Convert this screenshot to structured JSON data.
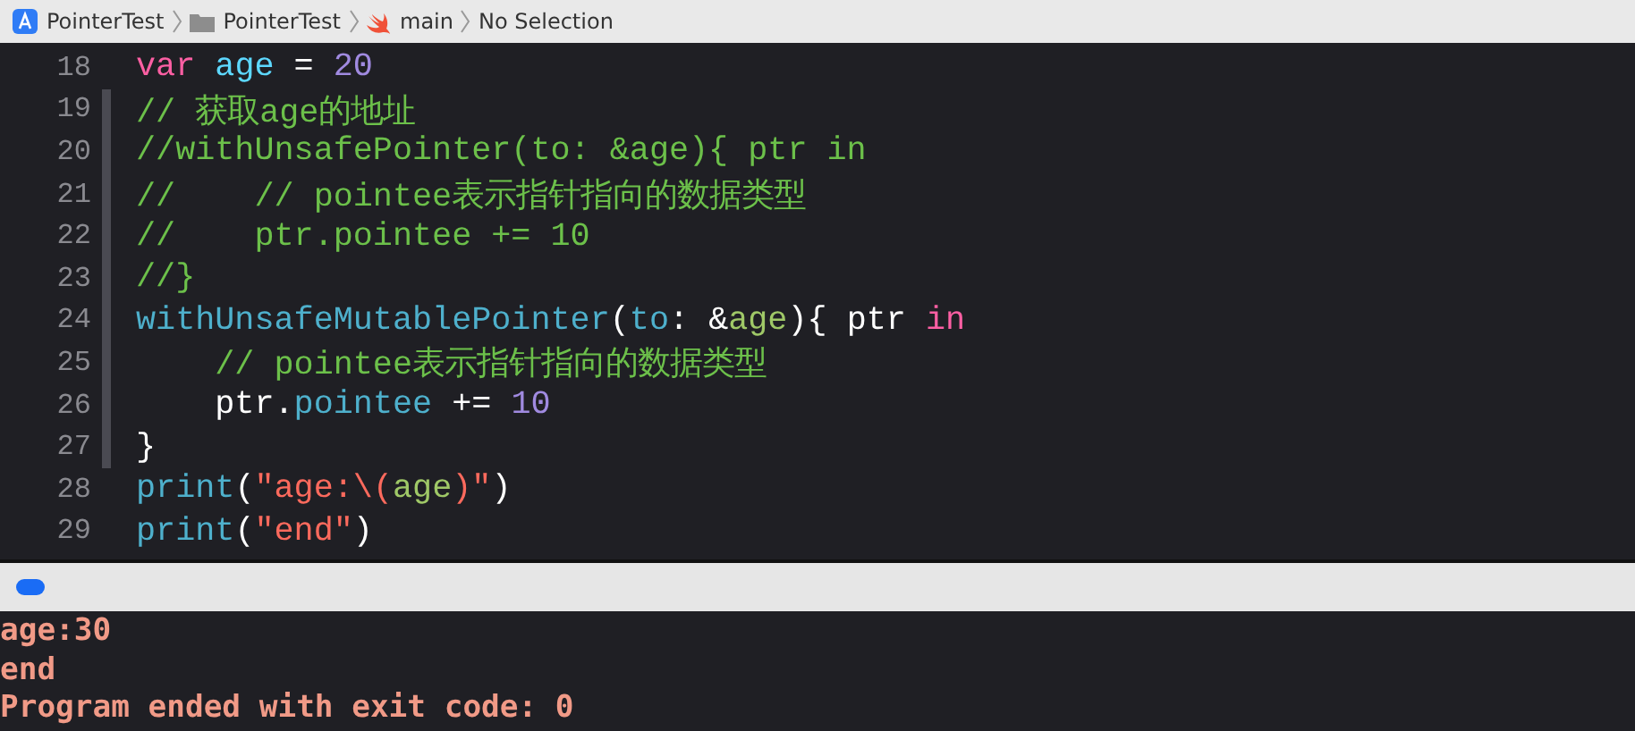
{
  "breadcrumbs": [
    {
      "kind": "app",
      "label": "PointerTest"
    },
    {
      "kind": "folder",
      "label": "PointerTest"
    },
    {
      "kind": "swift",
      "label": "main"
    },
    {
      "kind": "none",
      "label": "No Selection"
    }
  ],
  "editor": {
    "lines": [
      {
        "number": "18",
        "changed": false,
        "tokens": [
          {
            "kind": "keyword",
            "text": "var "
          },
          {
            "kind": "decl",
            "text": "age"
          },
          {
            "kind": "plain",
            "text": " = "
          },
          {
            "kind": "number",
            "text": "20"
          }
        ]
      },
      {
        "number": "19",
        "changed": true,
        "tokens": [
          {
            "kind": "comment",
            "text": "// 获取age的地址"
          }
        ]
      },
      {
        "number": "20",
        "changed": true,
        "tokens": [
          {
            "kind": "comment",
            "text": "//withUnsafePointer(to: &age){ ptr in"
          }
        ]
      },
      {
        "number": "21",
        "changed": true,
        "tokens": [
          {
            "kind": "comment",
            "text": "//    // pointee表示指针指向的数据类型"
          }
        ]
      },
      {
        "number": "22",
        "changed": true,
        "tokens": [
          {
            "kind": "comment",
            "text": "//    ptr.pointee += 10"
          }
        ]
      },
      {
        "number": "23",
        "changed": true,
        "tokens": [
          {
            "kind": "comment",
            "text": "//}"
          }
        ]
      },
      {
        "number": "24",
        "changed": true,
        "tokens": [
          {
            "kind": "function",
            "text": "withUnsafeMutablePointer"
          },
          {
            "kind": "plain",
            "text": "("
          },
          {
            "kind": "function",
            "text": "to"
          },
          {
            "kind": "plain",
            "text": ": &"
          },
          {
            "kind": "variable",
            "text": "age"
          },
          {
            "kind": "plain",
            "text": "){ ptr "
          },
          {
            "kind": "keyword",
            "text": "in"
          }
        ]
      },
      {
        "number": "25",
        "changed": true,
        "tokens": [
          {
            "kind": "comment",
            "text": "    // pointee表示指针指向的数据类型"
          }
        ]
      },
      {
        "number": "26",
        "changed": true,
        "tokens": [
          {
            "kind": "plain",
            "text": "    ptr."
          },
          {
            "kind": "function",
            "text": "pointee"
          },
          {
            "kind": "plain",
            "text": " += "
          },
          {
            "kind": "number",
            "text": "10"
          }
        ]
      },
      {
        "number": "27",
        "changed": true,
        "tokens": [
          {
            "kind": "plain",
            "text": "}"
          }
        ]
      },
      {
        "number": "28",
        "changed": false,
        "tokens": [
          {
            "kind": "function",
            "text": "print"
          },
          {
            "kind": "plain",
            "text": "("
          },
          {
            "kind": "string",
            "text": "\"age:\\("
          },
          {
            "kind": "variable",
            "text": "age"
          },
          {
            "kind": "string",
            "text": ")\""
          },
          {
            "kind": "plain",
            "text": ")"
          }
        ]
      },
      {
        "number": "29",
        "changed": false,
        "tokens": [
          {
            "kind": "function",
            "text": "print"
          },
          {
            "kind": "plain",
            "text": "("
          },
          {
            "kind": "string",
            "text": "\"end\""
          },
          {
            "kind": "plain",
            "text": ")"
          }
        ]
      }
    ]
  },
  "console": {
    "lines": [
      "age:30",
      "end",
      "Program ended with exit code: 0"
    ]
  }
}
